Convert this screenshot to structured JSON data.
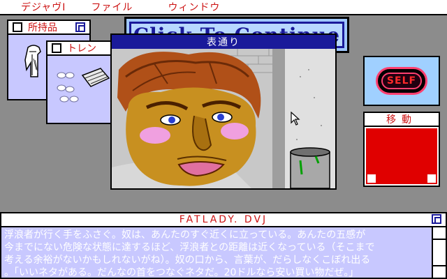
{
  "menu": {
    "items": [
      "デジャヴI",
      "ファイル",
      "ウィンドウ"
    ]
  },
  "inventory_window": {
    "title": "所持品"
  },
  "trash_window": {
    "title": "トレン"
  },
  "continue_button": {
    "label": "Click To Continue"
  },
  "view_window": {
    "title": "表通り"
  },
  "self_window": {
    "label": "SELF"
  },
  "move_window": {
    "title": "移動"
  },
  "text_window": {
    "title": "FATLADY. DVJ",
    "lines": [
      "浮浪者が行く手をふさぐ。奴は、あんたのすぐ近くに立っている。あんたの五感が",
      "今までにない危険な状態に達するほど、浮浪者との距離は近くなっている（そこまで",
      "考える余裕がないかもしれないがね）。奴の口から、言葉が、だらしなくこぼれ出る",
      "。「いいネタがある。だんなの首をつなぐネタだ。20ドルなら安い買い物だぜ。」"
    ]
  },
  "colors": {
    "menu_text": "#cc1111",
    "title_bar_active": "#1a1a9a",
    "desktop": "#8c8c8c",
    "text_bg": "#c8c8ff",
    "move_bg": "#e00000"
  }
}
